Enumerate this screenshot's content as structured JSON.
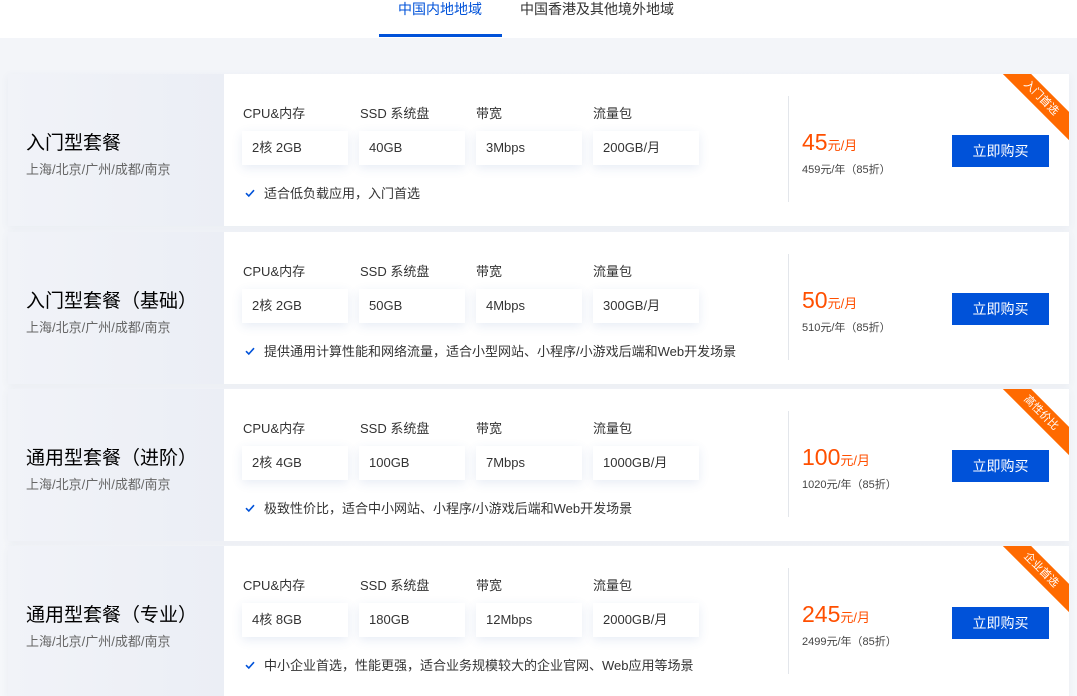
{
  "tabs": [
    {
      "label": "中国内地地域",
      "active": true
    },
    {
      "label": "中国香港及其他境外地域",
      "active": false
    }
  ],
  "spec_labels": {
    "cpu": "CPU&内存",
    "ssd": "SSD 系统盘",
    "bandwidth": "带宽",
    "traffic": "流量包"
  },
  "plans": [
    {
      "name": "入门型套餐",
      "region": "上海/北京/广州/成都/南京",
      "cpu": "2核 2GB",
      "ssd": "40GB",
      "bandwidth": "3Mbps",
      "traffic": "200GB/月",
      "desc": "适合低负载应用，入门首选",
      "price": "45",
      "price_unit": "元/月",
      "yearly": "459元/年（85折）",
      "button": "立即购买",
      "ribbon": "入门首选"
    },
    {
      "name": "入门型套餐（基础）",
      "region": "上海/北京/广州/成都/南京",
      "cpu": "2核 2GB",
      "ssd": "50GB",
      "bandwidth": "4Mbps",
      "traffic": "300GB/月",
      "desc": "提供通用计算性能和网络流量，适合小型网站、小程序/小游戏后端和Web开发场景",
      "price": "50",
      "price_unit": "元/月",
      "yearly": "510元/年（85折）",
      "button": "立即购买",
      "ribbon": ""
    },
    {
      "name": "通用型套餐（进阶）",
      "region": "上海/北京/广州/成都/南京",
      "cpu": "2核 4GB",
      "ssd": "100GB",
      "bandwidth": "7Mbps",
      "traffic": "1000GB/月",
      "desc": "极致性价比，适合中小网站、小程序/小游戏后端和Web开发场景",
      "price": "100",
      "price_unit": "元/月",
      "yearly": "1020元/年（85折）",
      "button": "立即购买",
      "ribbon": "高性价比"
    },
    {
      "name": "通用型套餐（专业）",
      "region": "上海/北京/广州/成都/南京",
      "cpu": "4核 8GB",
      "ssd": "180GB",
      "bandwidth": "12Mbps",
      "traffic": "2000GB/月",
      "desc": "中小企业首选，性能更强，适合业务规模较大的企业官网、Web应用等场景",
      "price": "245",
      "price_unit": "元/月",
      "yearly": "2499元/年（85折）",
      "button": "立即购买",
      "ribbon": "企业首选"
    }
  ],
  "colors": {
    "accent": "#0052d9",
    "price": "#ff4f00",
    "ribbon": "#ff6a00"
  }
}
